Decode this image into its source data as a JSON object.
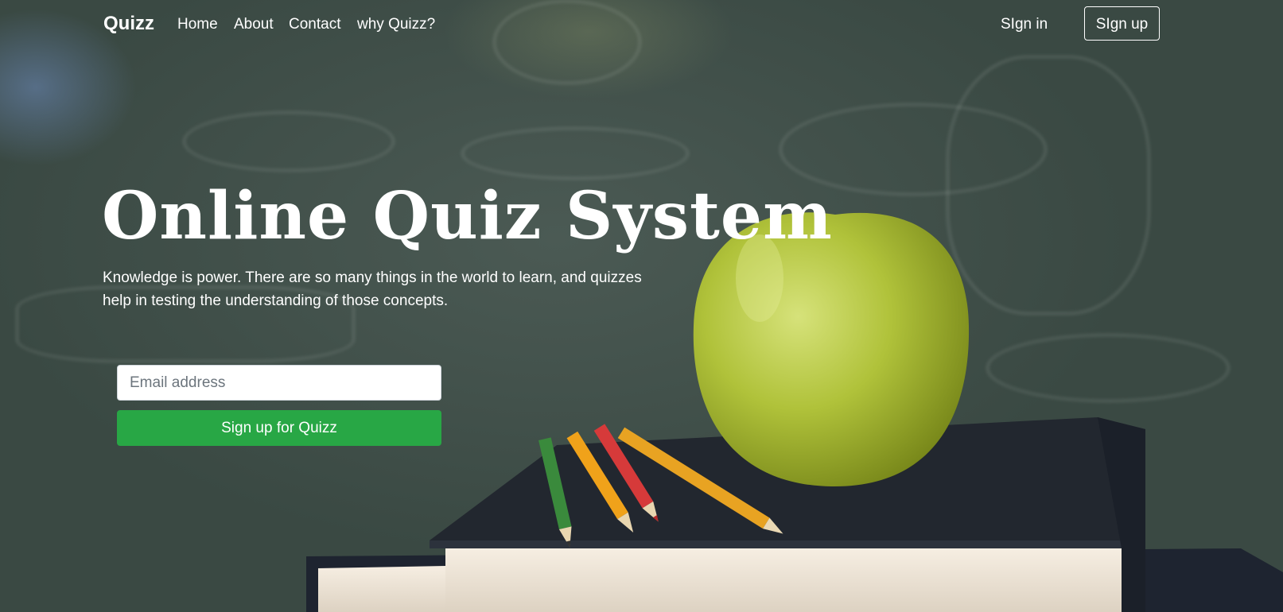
{
  "nav": {
    "brand": "Quizz",
    "links": [
      "Home",
      "About",
      "Contact",
      "why Quizz?"
    ],
    "signin": "SIgn in",
    "signup": "SIgn up"
  },
  "hero": {
    "title": "Online Quiz System",
    "text": "Knowledge is power. There are so many things in the world to learn, and quizzes help in testing the understanding of those concepts."
  },
  "form": {
    "email_placeholder": "Email address",
    "cta": "Sign up for Quizz"
  },
  "colors": {
    "accent": "#28a745",
    "chalkboard": "#3d4b45"
  }
}
